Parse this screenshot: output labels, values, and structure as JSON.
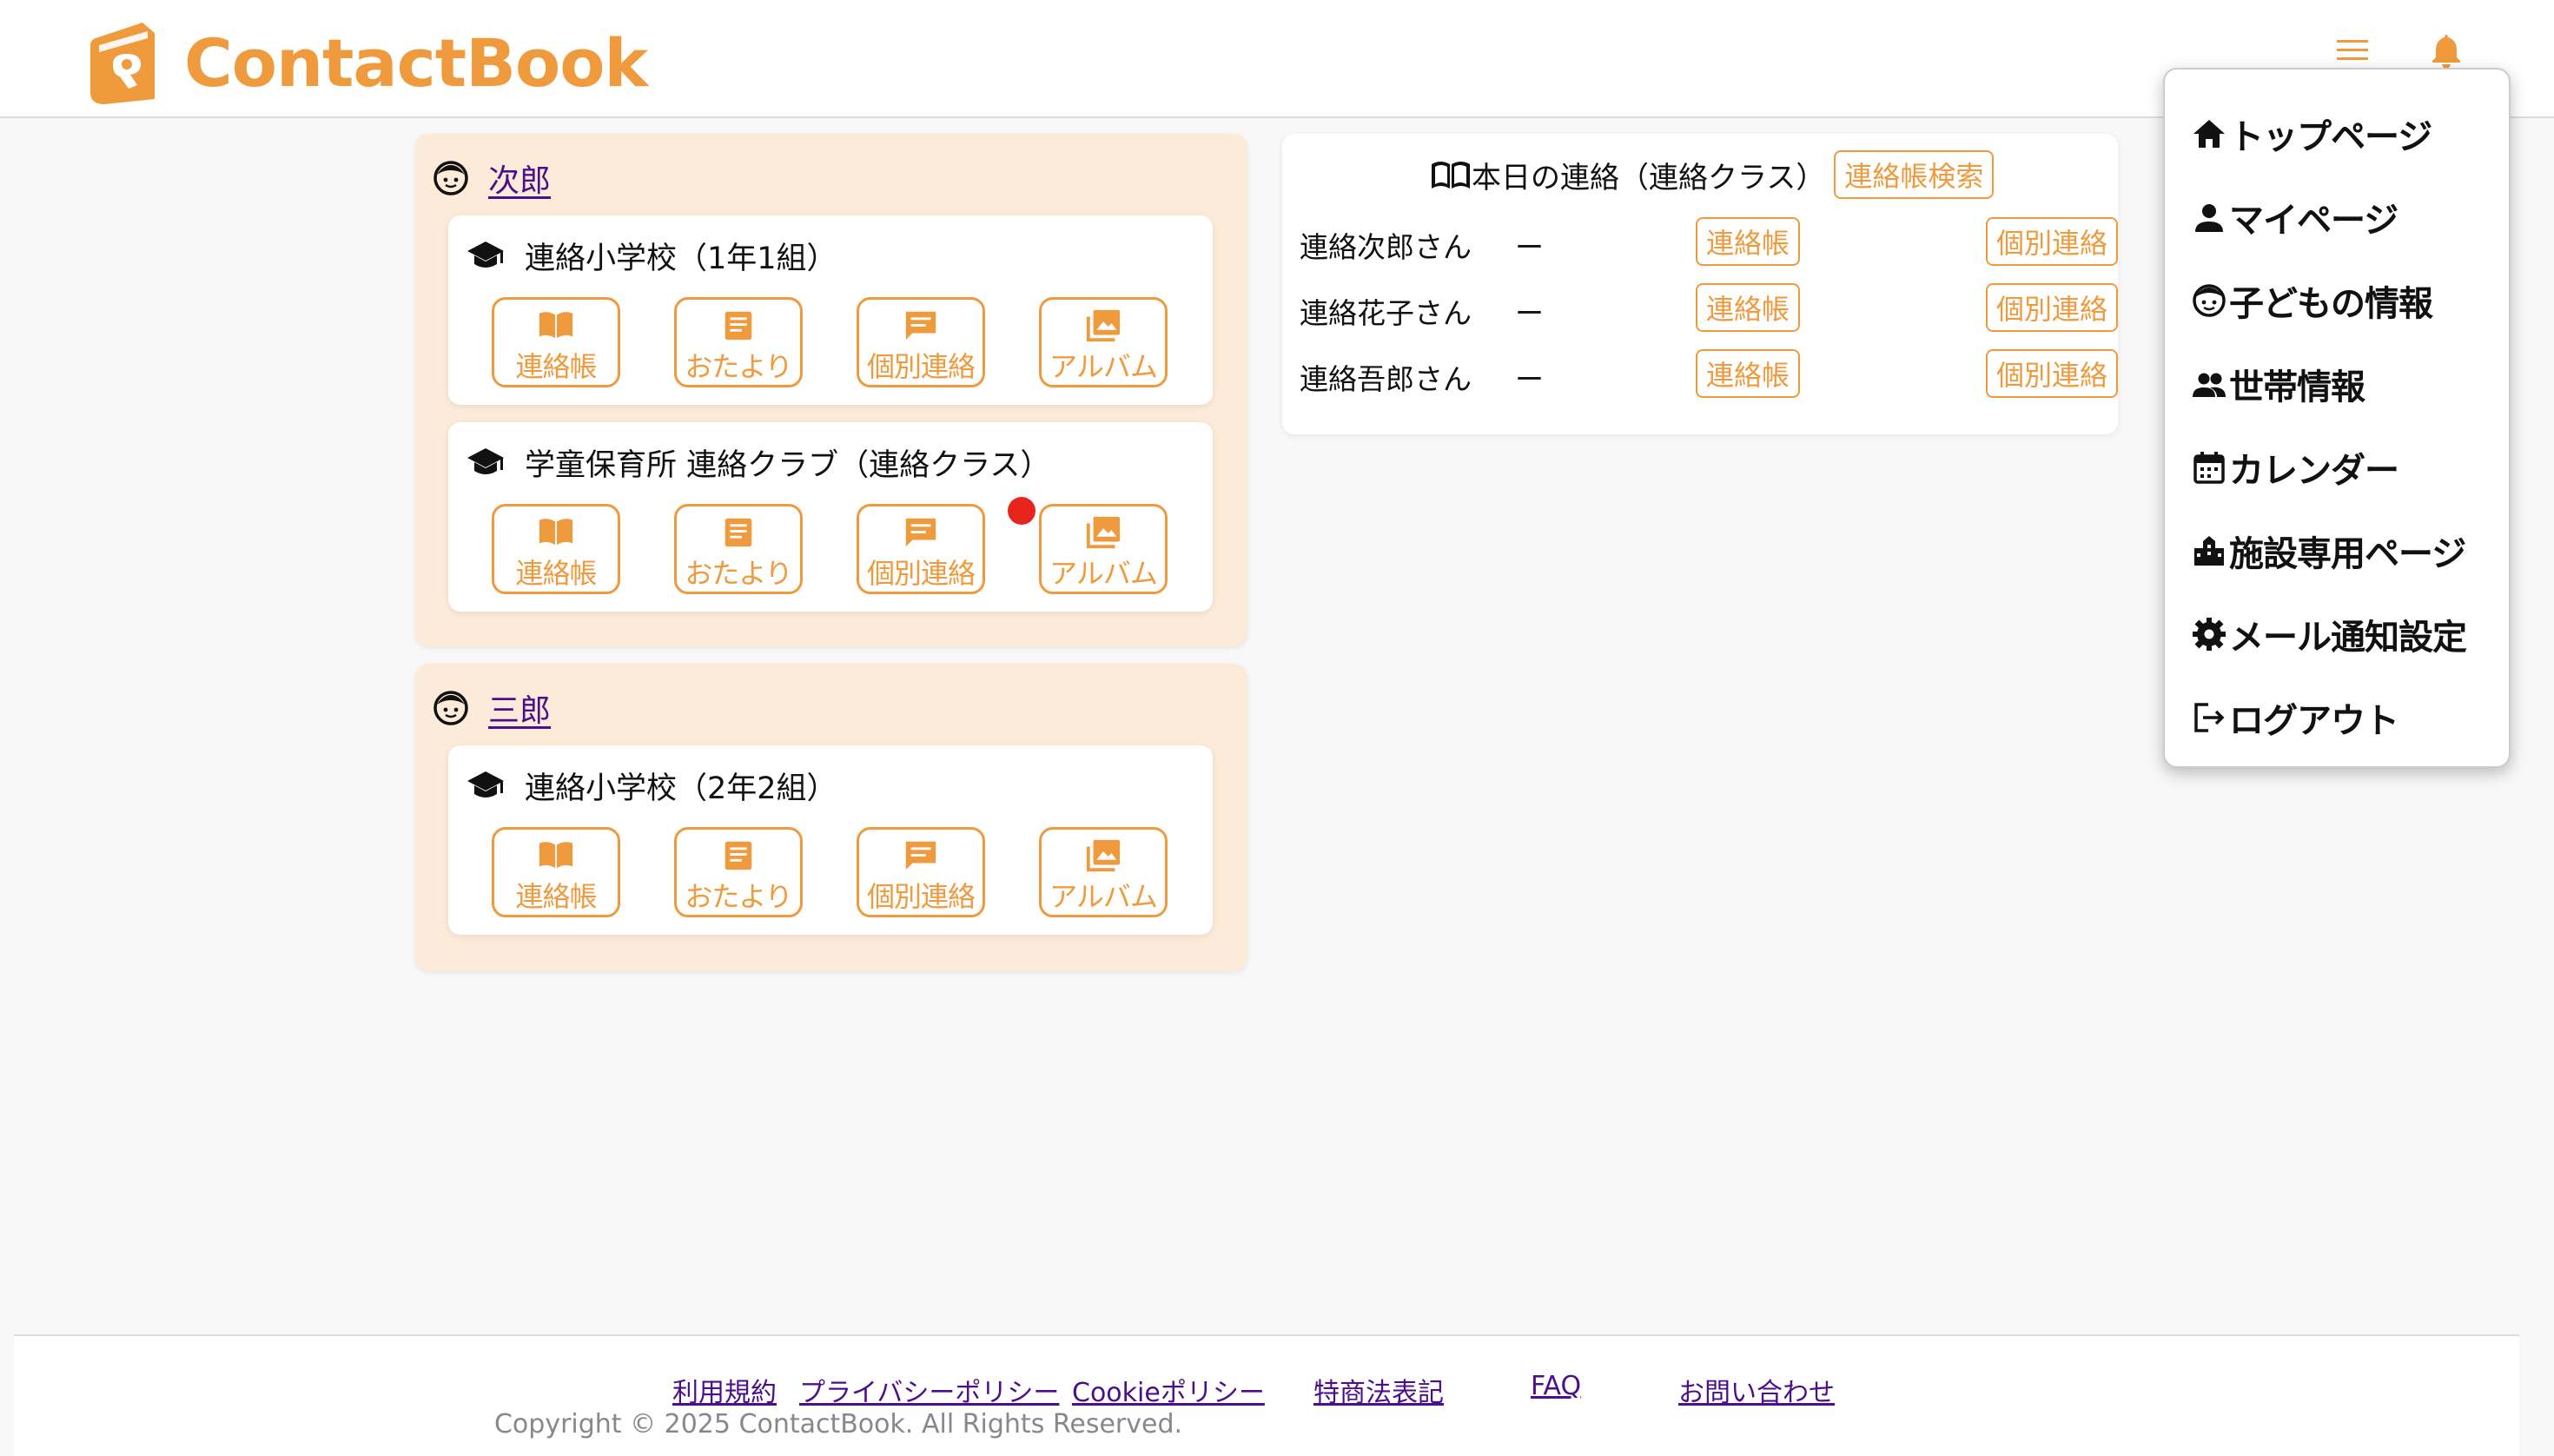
{
  "brand": {
    "name": "ContactBook",
    "accent": "#f09a3e",
    "card_bg": "#fdebd9",
    "link_color": "#4b0f8c",
    "badge_color": "#e8251c"
  },
  "header": {
    "menu_icon": "hamburger-icon",
    "notify_icon": "bell-icon"
  },
  "children": [
    {
      "name": "次郎",
      "schools": [
        {
          "name": "連絡小学校（1年1組）",
          "unread_badge": false
        },
        {
          "name": "学童保育所 連絡クラブ（連絡クラス）",
          "unread_badge": true
        }
      ]
    },
    {
      "name": "三郎",
      "schools": [
        {
          "name": "連絡小学校（2年2組）",
          "unread_badge": false
        }
      ]
    }
  ],
  "tiles": {
    "notebook": "連絡帳",
    "newsletter": "おたより",
    "individual": "個別連絡",
    "album": "アルバム"
  },
  "today": {
    "title": "本日の連絡（連絡クラス）",
    "search_label": "連絡帳検索",
    "rows": [
      {
        "name": "連絡次郎さん",
        "status": "ー",
        "notebook": "連絡帳",
        "individual": "個別連絡"
      },
      {
        "name": "連絡花子さん",
        "status": "ー",
        "notebook": "連絡帳",
        "individual": "個別連絡"
      },
      {
        "name": "連絡吾郎さん",
        "status": "ー",
        "notebook": "連絡帳",
        "individual": "個別連絡"
      }
    ]
  },
  "menu": [
    {
      "label": "トップページ",
      "icon": "home-icon"
    },
    {
      "label": "マイページ",
      "icon": "person-icon"
    },
    {
      "label": "子どもの情報",
      "icon": "child-face-icon"
    },
    {
      "label": "世帯情報",
      "icon": "group-icon"
    },
    {
      "label": "カレンダー",
      "icon": "calendar-icon"
    },
    {
      "label": "施設専用ページ",
      "icon": "building-icon"
    },
    {
      "label": "メール通知設定",
      "icon": "gear-icon"
    },
    {
      "label": "ログアウト",
      "icon": "logout-icon"
    }
  ],
  "footer": {
    "links": [
      "利用規約",
      "プライバシーポリシー",
      "Cookieポリシー",
      "特商法表記",
      "FAQ",
      "お問い合わせ"
    ],
    "copyright": "Copyright © 2025 ContactBook. All Rights Reserved."
  }
}
